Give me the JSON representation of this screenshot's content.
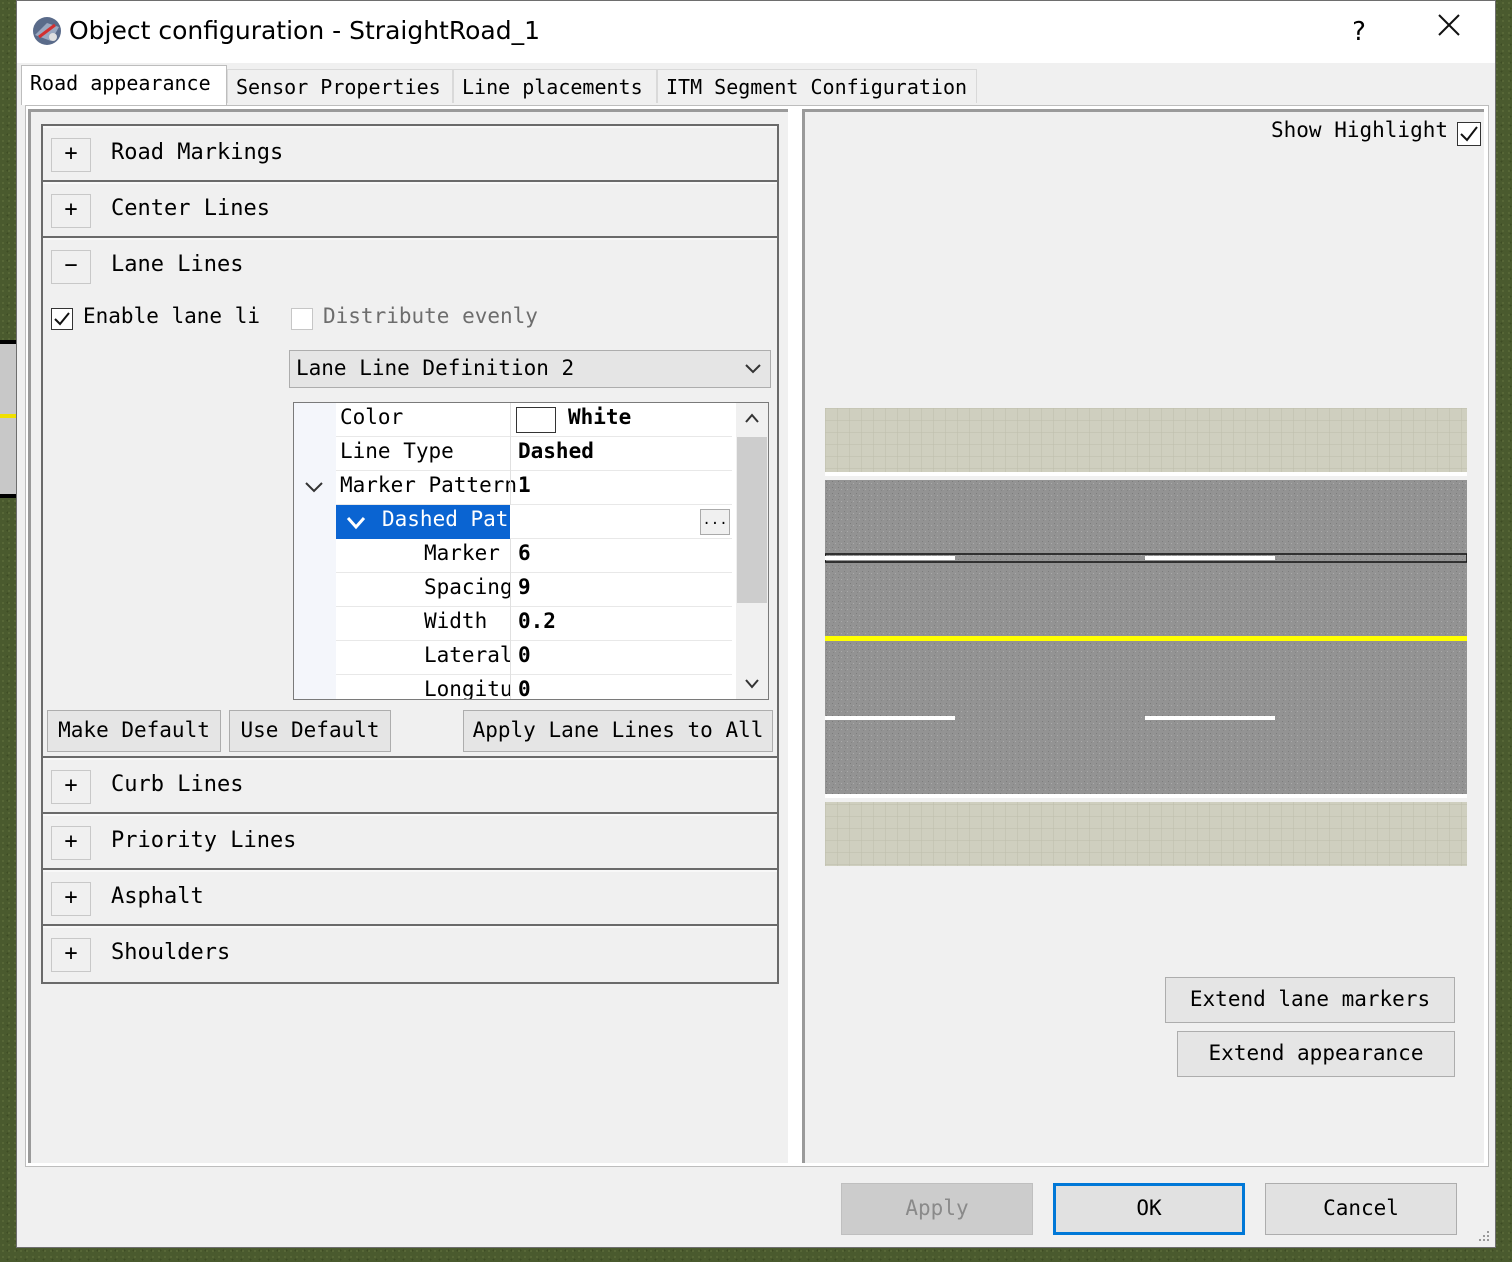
{
  "window": {
    "title": "Object configuration - StraightRoad_1",
    "help_label": "?"
  },
  "tabs": [
    {
      "label": "Road appearance"
    },
    {
      "label": "Sensor Properties"
    },
    {
      "label": "Line placements"
    },
    {
      "label": "ITM Segment Configuration"
    }
  ],
  "sections": {
    "road_markings": {
      "toggle": "+",
      "label": "Road Markings"
    },
    "center_lines": {
      "toggle": "+",
      "label": "Center Lines"
    },
    "lane_lines": {
      "toggle": "−",
      "label": "Lane Lines"
    },
    "curb_lines": {
      "toggle": "+",
      "label": "Curb Lines"
    },
    "priority_lines": {
      "toggle": "+",
      "label": "Priority Lines"
    },
    "asphalt": {
      "toggle": "+",
      "label": "Asphalt"
    },
    "shoulders": {
      "toggle": "+",
      "label": "Shoulders"
    }
  },
  "lane_lines": {
    "enable_label": "Enable lane li",
    "enable_checked": true,
    "distribute_label": "Distribute evenly",
    "distribute_checked": false,
    "definition_selected": "Lane Line Definition 2",
    "properties": {
      "color": {
        "name": "Color",
        "value": "White",
        "swatch": "#ffffff"
      },
      "line_type": {
        "name": "Line Type",
        "value": "Dashed"
      },
      "marker_pattern": {
        "name": "Marker Pattern",
        "value": "1"
      },
      "dashed_pattern": {
        "name": "Dashed Pat",
        "ellipsis": "..."
      },
      "marker": {
        "name": "Marker",
        "value": "6"
      },
      "spacing": {
        "name": "Spacing",
        "value": "9"
      },
      "width": {
        "name": "Width",
        "value": "0.2"
      },
      "lateral": {
        "name": "Lateral",
        "value": "0"
      },
      "longitu": {
        "name": "Longitu",
        "value": "0"
      }
    },
    "make_default": "Make Default",
    "use_default": "Use Default",
    "apply_all": "Apply Lane Lines to All"
  },
  "preview": {
    "show_highlight_label": "Show Highlight",
    "show_highlight_checked": true,
    "extend_lane_markers": "Extend lane markers",
    "extend_appearance": "Extend appearance",
    "colors": {
      "asphalt": "#8e8e8e",
      "shoulder": "#c9c9b8",
      "center_line": "#ffff00",
      "lane_marking": "#ffffff",
      "highlight": "#0a64d2"
    }
  },
  "footer": {
    "apply": "Apply",
    "ok": "OK",
    "cancel": "Cancel"
  }
}
